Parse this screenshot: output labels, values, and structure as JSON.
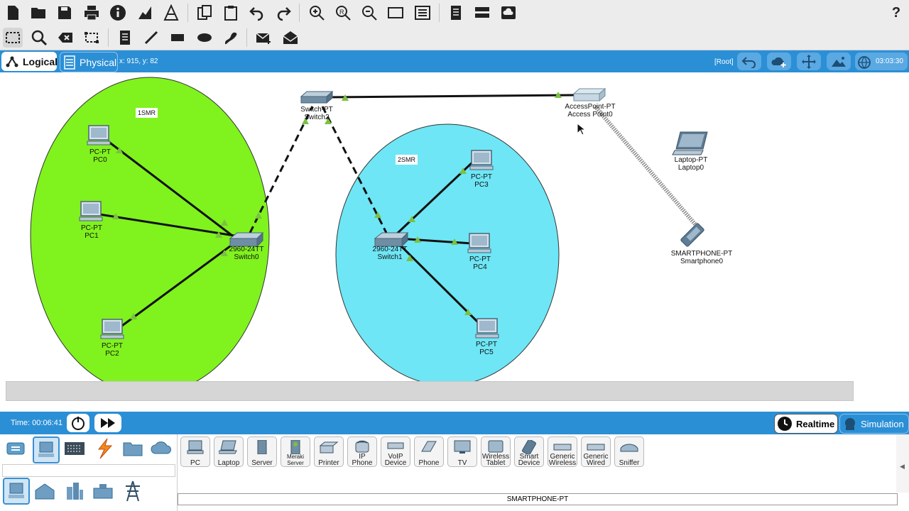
{
  "toolbar": {
    "row1_icons": [
      "new-file-icon",
      "open-folder-icon",
      "save-icon",
      "print-icon",
      "info-icon",
      "activity-wizard-icon",
      "network-icon",
      "copy-icon",
      "paste-icon",
      "undo-icon",
      "redo-icon",
      "zoom-in-icon",
      "zoom-reset-icon",
      "zoom-out-icon",
      "drawing-palette-icon",
      "custom-device-icon",
      "pdu-list-icon",
      "cluster-icon",
      "cloud-icon"
    ],
    "help_label": "?"
  },
  "workspace": {
    "logical_label": "Logical",
    "physical_label": "Physical",
    "coords": "x: 915, y: 82",
    "root_label": "[Root]",
    "clock": "03:03:30"
  },
  "canvas": {
    "notes": [
      "1SMR",
      "2SMR"
    ],
    "devices": [
      {
        "type": "PC-PT",
        "name": "PC0"
      },
      {
        "type": "PC-PT",
        "name": "PC1"
      },
      {
        "type": "PC-PT",
        "name": "PC2"
      },
      {
        "type": "2960-24TT",
        "name": "Switch0"
      },
      {
        "type": "Switch-PT",
        "name": "Switch2"
      },
      {
        "type": "AccessPoint-PT",
        "name": "Access Point0"
      },
      {
        "type": "Laptop-PT",
        "name": "Laptop0"
      },
      {
        "type": "SMARTPHONE-PT",
        "name": "Smartphone0"
      },
      {
        "type": "2960-24TT",
        "name": "Switch1"
      },
      {
        "type": "PC-PT",
        "name": "PC3"
      },
      {
        "type": "PC-PT",
        "name": "PC4"
      },
      {
        "type": "PC-PT",
        "name": "PC5"
      }
    ],
    "colors": {
      "zone1": "#80f21e",
      "zone2": "#6ee6f5",
      "link_up": "#7ac142"
    }
  },
  "bottom": {
    "time": "Time: 00:06:41",
    "realtime_label": "Realtime",
    "simulation_label": "Simulation"
  },
  "palette": {
    "devices": [
      "PC",
      "Laptop",
      "Server",
      "Meraki Server",
      "Printer",
      "IP Phone",
      "VoIP Device",
      "Phone",
      "TV",
      "Wireless Tablet",
      "Smart Device",
      "Generic Wireless",
      "Generic Wired",
      "Sniffer"
    ],
    "selected": "SMARTPHONE-PT"
  }
}
